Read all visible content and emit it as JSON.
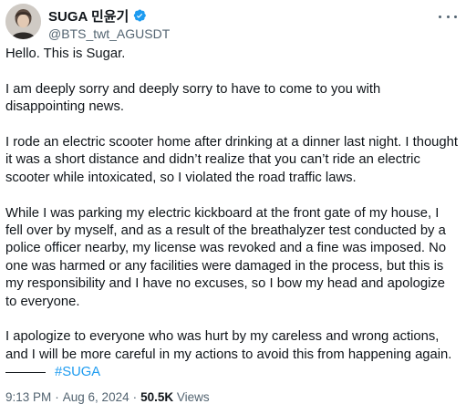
{
  "author": {
    "display_name": "SUGA 민윤기",
    "handle": "@BTS_twt_AGUSDT",
    "verified_icon": "verified-badge-icon",
    "avatar_icon": "avatar-photo"
  },
  "tweet": {
    "paragraphs": [
      "Hello. This is Sugar.",
      "I am deeply sorry and deeply sorry to have to come to you with disappointing news.",
      "I rode an electric scooter home after drinking at a dinner last night. I thought it was a short distance and didn’t realize that you can’t ride an electric scooter while intoxicated, so I violated the road traffic laws.",
      "While I was parking my electric kickboard at the front gate of my house, I fell over by myself, and as a result of the breathalyzer test conducted by a police officer nearby, my license was revoked and a fine was imposed. No one was harmed or any facilities were damaged in the process, but this is my responsibility and I have no excuses, so I bow my head and apologize to everyone.",
      "I apologize to everyone who was hurt by my careless and wrong actions, and I will be more careful in my actions to avoid this from happening again."
    ],
    "hashtag": "#SUGA"
  },
  "meta": {
    "time": "9:13 PM",
    "separator": "·",
    "date": "Aug 6, 2024",
    "views_count": "50.5K",
    "views_label": "Views"
  },
  "colors": {
    "text": "#0f1419",
    "secondary": "#536471",
    "accent": "#1d9bf0"
  }
}
